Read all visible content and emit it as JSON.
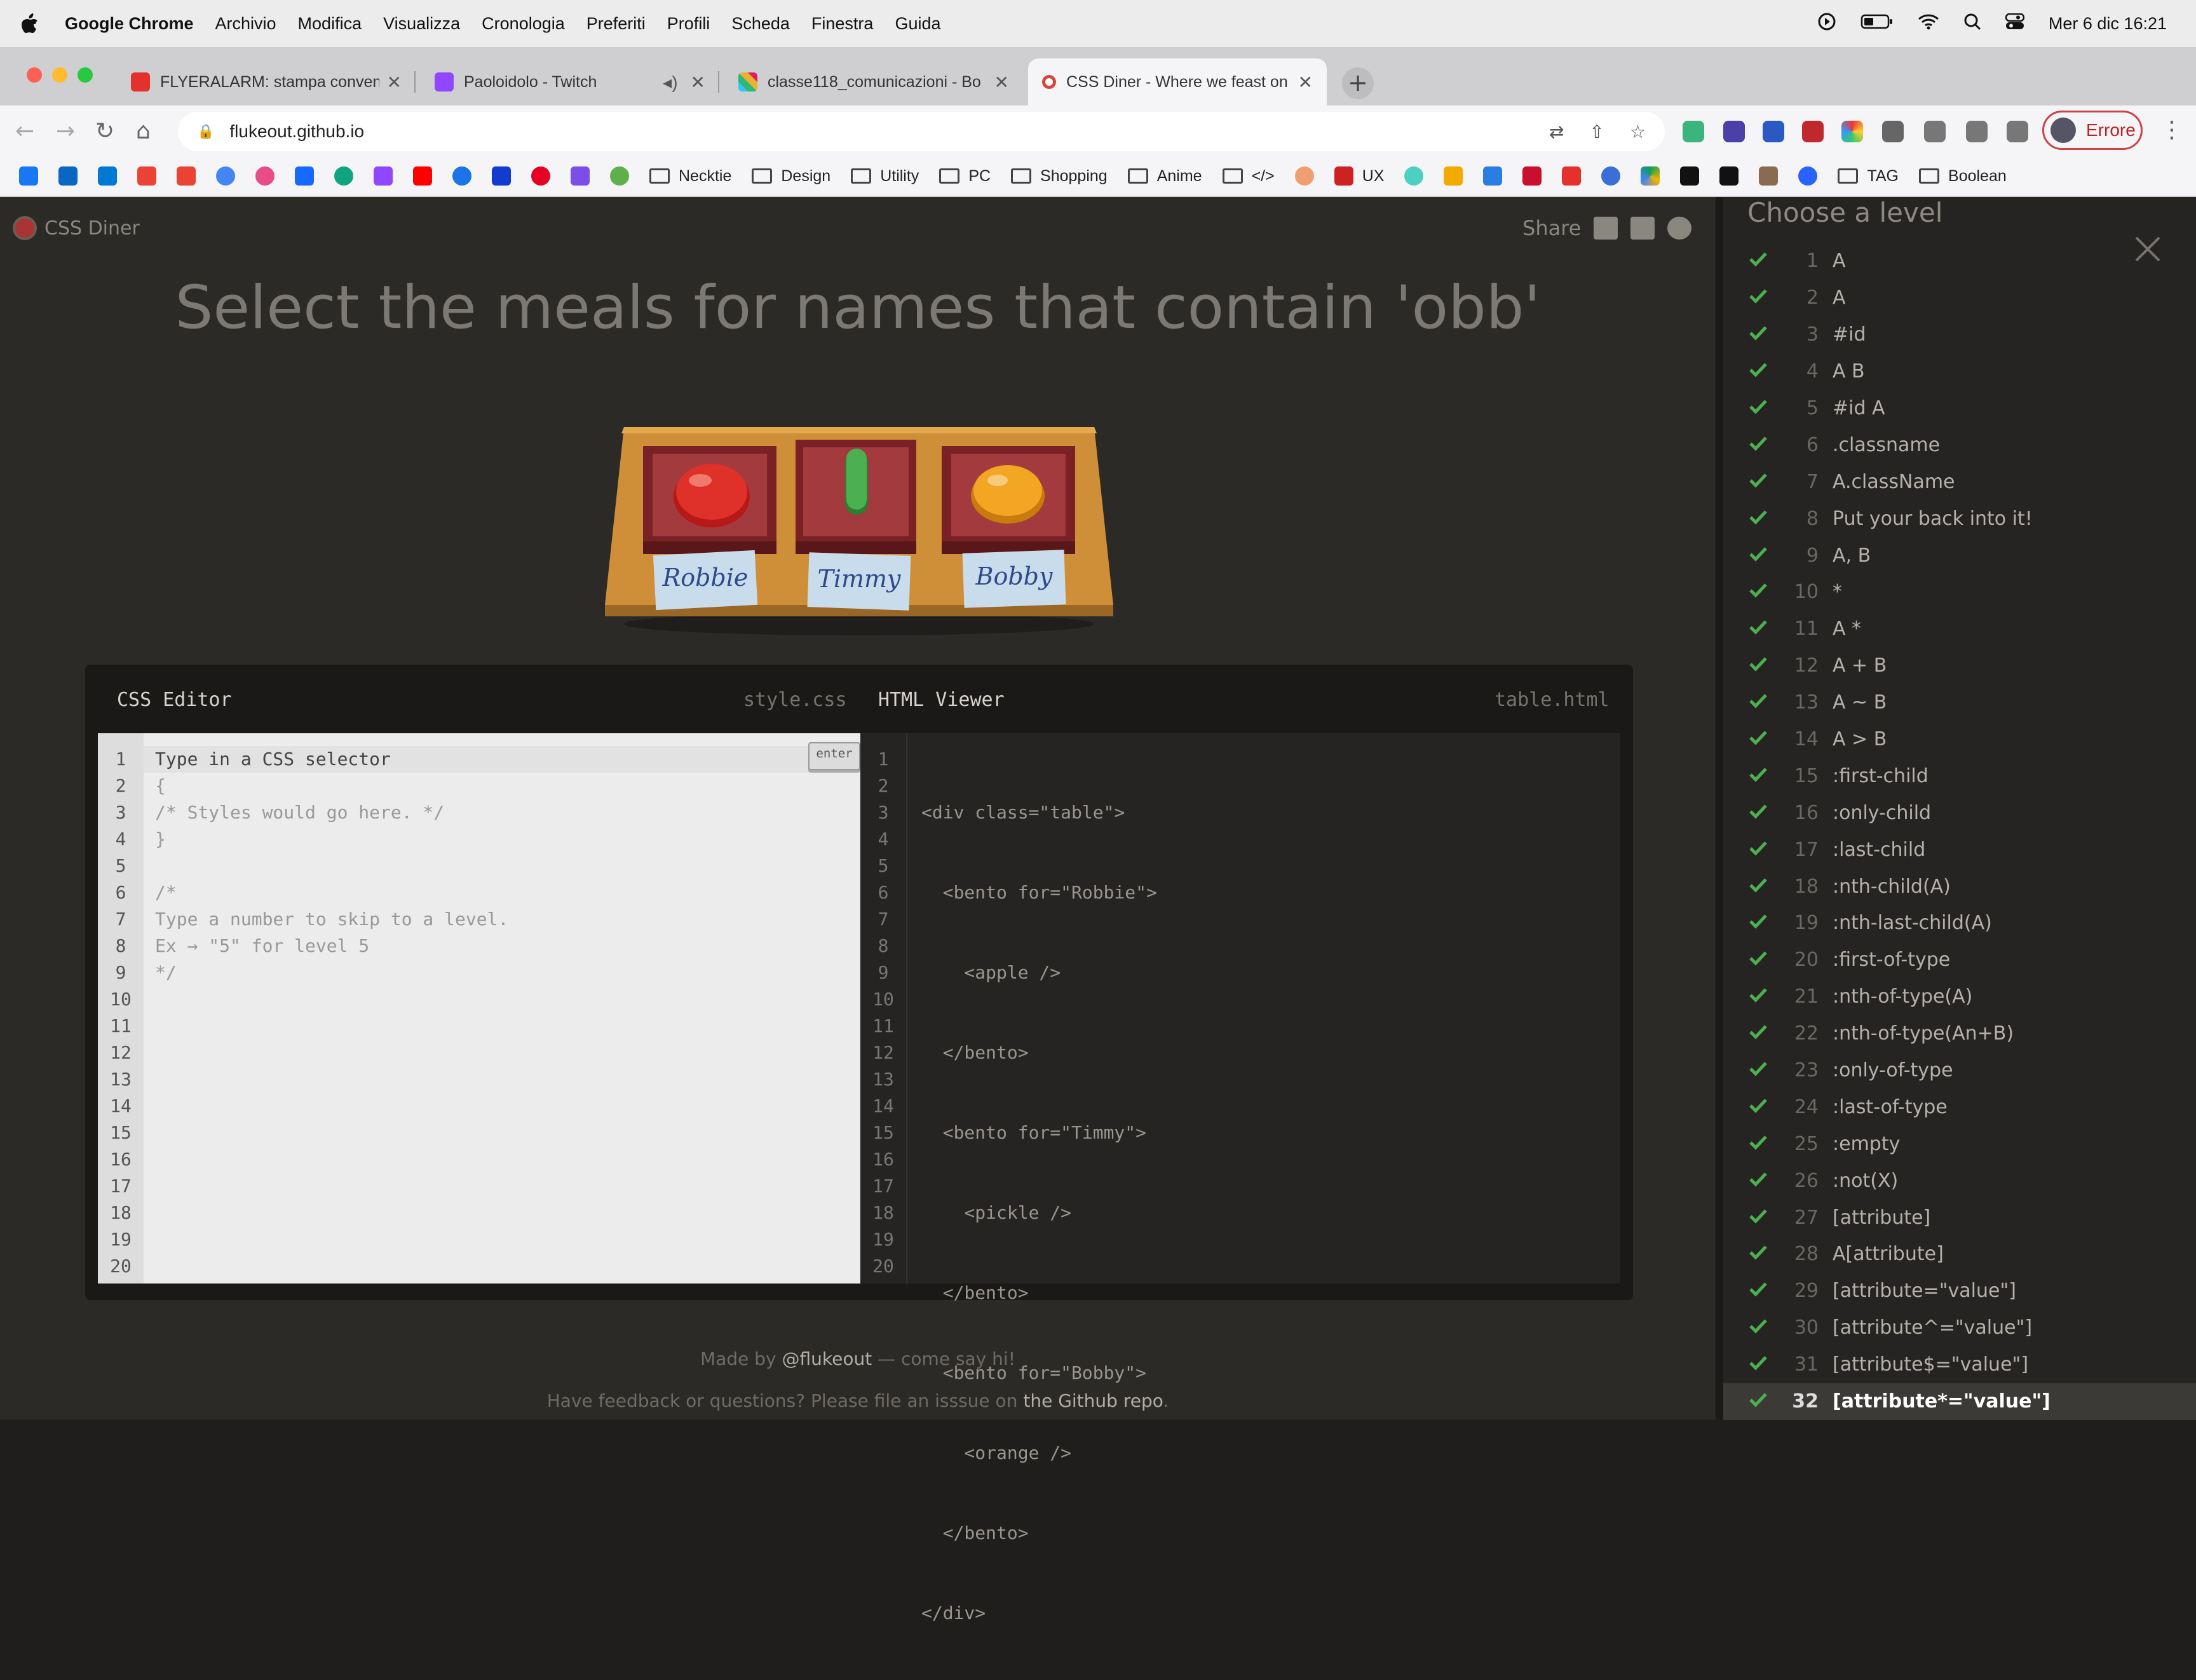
{
  "menubar": {
    "app": "Google Chrome",
    "items": [
      "Archivio",
      "Modifica",
      "Visualizza",
      "Cronologia",
      "Preferiti",
      "Profili",
      "Scheda",
      "Finestra",
      "Guida"
    ],
    "clock": "Mer 6 dic  16:21"
  },
  "tabs": [
    {
      "title": "FLYERALARM: stampa convenzionale",
      "favicon_color": "#e4312b"
    },
    {
      "title": "Paoloidolo - Twitch",
      "favicon_color": "#9146ff"
    },
    {
      "title": "classe118_comunicazioni - Bo",
      "favicon_color": "#36c5f0"
    },
    {
      "title": "CSS Diner - Where we feast on",
      "favicon_color": "#d9453c"
    }
  ],
  "address": {
    "url": "flukeout.github.io"
  },
  "profile": {
    "label": "Errore"
  },
  "bookmarks": {
    "folders": [
      "Necktie",
      "Design",
      "Utility",
      "PC",
      "Shopping",
      "Anime",
      "</>",
      "UX",
      "TAG",
      "Boolean"
    ]
  },
  "site": {
    "logo": "CSS Diner",
    "share": "Share",
    "instruction": "Select the meals for names that contain 'obb'",
    "plates": [
      "Robbie",
      "Timmy",
      "Bobby"
    ]
  },
  "editor": {
    "css_title": "CSS Editor",
    "css_file": "style.css",
    "html_title": "HTML Viewer",
    "html_file": "table.html",
    "enter": "enter",
    "line_numbers": [
      "1",
      "2",
      "3",
      "4",
      "5",
      "6",
      "7",
      "8",
      "9",
      "10",
      "11",
      "12",
      "13",
      "14",
      "15",
      "16",
      "17",
      "18",
      "19",
      "20"
    ],
    "css_lines": [
      "Type in a CSS selector",
      "{",
      "/* Styles would go here. */",
      "}",
      "",
      "/*",
      "Type a number to skip to a level.",
      "Ex → \"5\" for level 5",
      "*/"
    ],
    "html_lines": [
      "<div class=\"table\">",
      "  <bento for=\"Robbie\">",
      "    <apple />",
      "  </bento>",
      "  <bento for=\"Timmy\">",
      "    <pickle />",
      "  </bento>",
      "  <bento for=\"Bobby\">",
      "    <orange />",
      "  </bento>",
      "</div>"
    ]
  },
  "footer": {
    "line1_pre": "Made by ",
    "line1_link": "@flukeout",
    "line1_post": " — come say hi!",
    "line2_pre": "Have feedback or questions? Please file an isssue on ",
    "line2_link": "the Github repo",
    "line2_post": "."
  },
  "sidebar": {
    "title": "Choose a level",
    "levels": [
      {
        "n": "1",
        "label": "A"
      },
      {
        "n": "2",
        "label": "A"
      },
      {
        "n": "3",
        "label": "#id"
      },
      {
        "n": "4",
        "label": "A  B"
      },
      {
        "n": "5",
        "label": "#id  A"
      },
      {
        "n": "6",
        "label": ".classname"
      },
      {
        "n": "7",
        "label": "A.className"
      },
      {
        "n": "8",
        "label": "Put your back into it!"
      },
      {
        "n": "9",
        "label": "A, B"
      },
      {
        "n": "10",
        "label": "*"
      },
      {
        "n": "11",
        "label": "A  *"
      },
      {
        "n": "12",
        "label": "A + B"
      },
      {
        "n": "13",
        "label": "A ~ B"
      },
      {
        "n": "14",
        "label": "A > B"
      },
      {
        "n": "15",
        "label": ":first-child"
      },
      {
        "n": "16",
        "label": ":only-child"
      },
      {
        "n": "17",
        "label": ":last-child"
      },
      {
        "n": "18",
        "label": ":nth-child(A)"
      },
      {
        "n": "19",
        "label": ":nth-last-child(A)"
      },
      {
        "n": "20",
        "label": ":first-of-type"
      },
      {
        "n": "21",
        "label": ":nth-of-type(A)"
      },
      {
        "n": "22",
        "label": ":nth-of-type(An+B)"
      },
      {
        "n": "23",
        "label": ":only-of-type"
      },
      {
        "n": "24",
        "label": ":last-of-type"
      },
      {
        "n": "25",
        "label": ":empty"
      },
      {
        "n": "26",
        "label": ":not(X)"
      },
      {
        "n": "27",
        "label": "[attribute]"
      },
      {
        "n": "28",
        "label": "A[attribute]"
      },
      {
        "n": "29",
        "label": "[attribute=\"value\"]"
      },
      {
        "n": "30",
        "label": "[attribute^=\"value\"]"
      },
      {
        "n": "31",
        "label": "[attribute$=\"value\"]"
      },
      {
        "n": "32",
        "label": "[attribute*=\"value\"]"
      }
    ],
    "current": "32"
  }
}
